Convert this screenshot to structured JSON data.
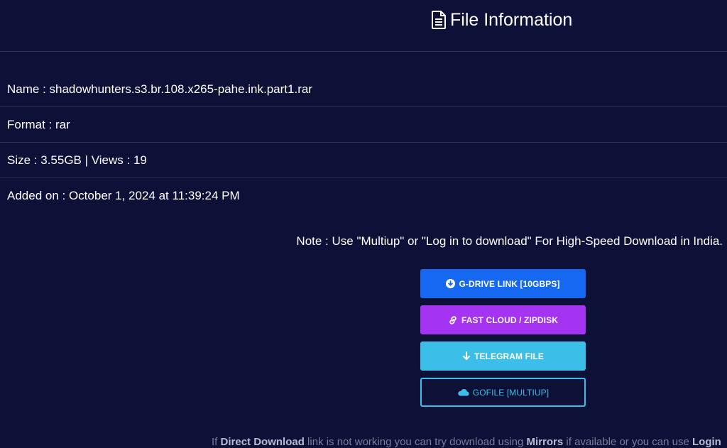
{
  "header": {
    "title": "File Information",
    "icon": "file-text-icon"
  },
  "file_info": {
    "name_line": "Name : shadowhunters.s3.br.108.x265-pahe.ink.part1.rar",
    "format_line": "Format : rar",
    "size_views_line": "Size : 3.55GB | Views : 19",
    "added_line": "Added on : October 1, 2024 at 11:39:24 PM"
  },
  "note": "Note : Use \"Multiup\" or \"Log in to download\" For High-Speed Download in India.",
  "buttons": {
    "gdrive": {
      "label": "G-DRIVE LINK [10GBPS]",
      "icon": "download-circle-icon",
      "color": "#1668f0"
    },
    "fastcloud": {
      "label": "FAST CLOUD / ZIPDISK",
      "icon": "link-icon",
      "color": "#a533f2"
    },
    "telegram": {
      "label": "TELEGRAM FILE",
      "icon": "arrow-down-icon",
      "color": "#3bbfe9"
    },
    "gofile": {
      "label": "GOFILE [MULTIUP]",
      "icon": "cloud-icon",
      "color": "#3bbfe9"
    }
  },
  "footer": {
    "part1": "If ",
    "bold1": "Direct Download",
    "part2": " link is not working you can try download using ",
    "bold2": "Mirrors",
    "part3": " if available or you can use ",
    "bold3": "Login"
  },
  "colors": {
    "background": "#0d1137",
    "divider": "#2c3059"
  }
}
